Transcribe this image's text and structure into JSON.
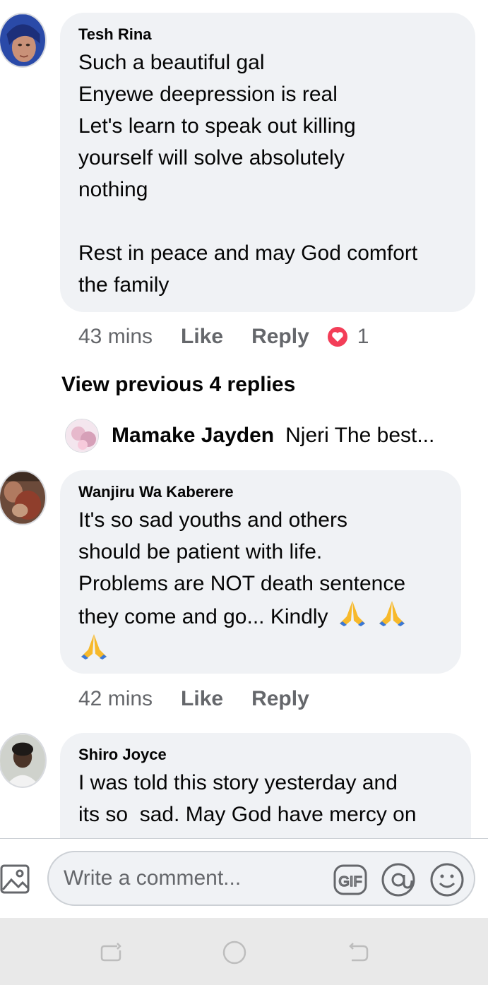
{
  "comments": [
    {
      "author": "Tesh Rina",
      "text": "Such a beautiful gal\nEnyewe deepression is real\nLet's learn to speak out killing\nyourself will solve absolutely\nnothing\n\nRest in peace and may God comfort\nthe family",
      "time": "43 mins",
      "like_label": "Like",
      "reply_label": "Reply",
      "reaction_icon": "heart-reaction-icon",
      "reaction_count": "1"
    },
    {
      "author": "Wanjiru Wa Kaberere",
      "text": "It's so sad youths and others\nshould be patient with life.\nProblems are NOT death sentence\nthey come and go... Kindly",
      "emoji": "folded-hands-icon",
      "time": "42 mins",
      "like_label": "Like",
      "reply_label": "Reply"
    },
    {
      "author": "Shiro Joyce",
      "text": "I was told this story yesterday and\nits so  sad. May God have mercy on"
    }
  ],
  "view_previous_label": "View previous 4 replies",
  "reply_preview": {
    "author": "Mamake Jayden",
    "snippet": "Njeri The best..."
  },
  "composer": {
    "placeholder": "Write a comment...",
    "icons": [
      "photo-icon",
      "gif-icon",
      "mention-icon",
      "emoji-icon"
    ]
  },
  "colors": {
    "bubble": "#f0f2f5",
    "muted_text": "#65676b",
    "heart": "#f33e58"
  }
}
